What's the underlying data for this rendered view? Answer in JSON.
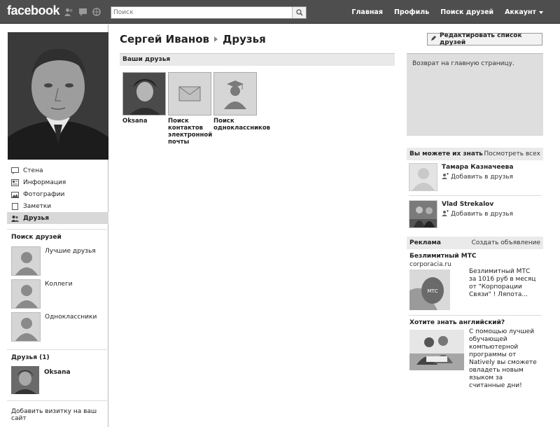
{
  "topbar": {
    "logo": "facebook",
    "search_placeholder": "Поиск",
    "nav": [
      "Главная",
      "Профиль",
      "Поиск друзей",
      "Аккаунт"
    ]
  },
  "leftnav": {
    "items": [
      "Стена",
      "Информация",
      "Фотографии",
      "Заметки",
      "Друзья"
    ],
    "find_friends_heading": "Поиск друзей",
    "lists": [
      "Лучшие друзья",
      "Коллеги",
      "Одноклассники"
    ],
    "friends_heading": "Друзья (1)",
    "friend_name": "Oksana",
    "add_card": "Добавить визитку на ваш сайт"
  },
  "main": {
    "title_name": "Сергей Иванов",
    "title_section": "Друзья",
    "edit_button": "Редактировать список друзей",
    "your_friends": "Ваши друзья",
    "tiles": [
      {
        "caption": "Oksana"
      },
      {
        "caption": "Поиск контактов электронной почты"
      },
      {
        "caption": "Поиск одноклассников"
      }
    ]
  },
  "right": {
    "return_text": "Возврат на главную страницу.",
    "pymk_heading": "Вы можете их знать",
    "pymk_see_all": "Посмотреть всех",
    "people": [
      {
        "name": "Тамара Казначеева",
        "action": "Добавить в друзья"
      },
      {
        "name": "Vlad Strekalov",
        "action": "Добавить в друзья"
      }
    ],
    "ads_heading": "Реклама",
    "ads_create": "Создать объявление",
    "ads": [
      {
        "title": "Безлимитный МТС",
        "domain": "corporacia.ru",
        "text": "Безлимитный МТС за 1016 руб в месяц от \"Корпорации Связи\" ! Ляпота...",
        "badge": "МТС"
      },
      {
        "title": "Хотите знать английский?",
        "text": "С помощью лучшей обучающей компьютерной программы от Natively вы сможете овладеть новым языком за считанные дни!"
      }
    ]
  }
}
